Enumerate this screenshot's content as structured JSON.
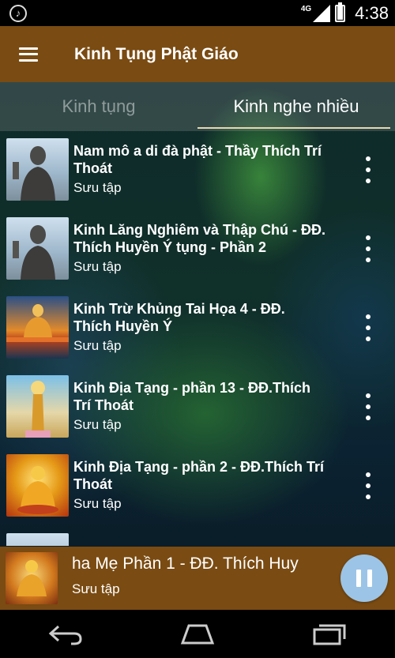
{
  "status_bar": {
    "network": "4G",
    "time": "4:38"
  },
  "toolbar": {
    "title": "Kinh Tụng Phật Giáo"
  },
  "tabs": [
    {
      "label": "Kinh tụng",
      "active": false
    },
    {
      "label": "Kinh nghe nhiều",
      "active": true
    }
  ],
  "list": {
    "items": [
      {
        "title": "Nam mô a di đà phật - Thầy Thích Trí Thoát",
        "subtitle": "Sưu tập",
        "thumb": "buddha-statue"
      },
      {
        "title": "Kinh Lăng Nghiêm và Thập Chú - ĐĐ. Thích Huyền Ý tụng - Phần 2",
        "subtitle": "Sưu tập",
        "thumb": "buddha-statue"
      },
      {
        "title": "Kinh Trừ Khủng Tai Họa 4 - ĐĐ. Thích Huyền Ý",
        "subtitle": "Sưu tập",
        "thumb": "buddha-sunset"
      },
      {
        "title": "Kinh Địa Tạng - phần 13 - ĐĐ.Thích Trí Thoát",
        "subtitle": "Sưu tập",
        "thumb": "bodhisattva-sky"
      },
      {
        "title": "Kinh Địa Tạng - phần 2 - ĐĐ.Thích Trí Thoát",
        "subtitle": "Sưu tập",
        "thumb": "golden-buddha"
      }
    ]
  },
  "now_playing": {
    "title": "ha Mẹ Phần 1 - ĐĐ. Thích Huy",
    "subtitle": "Sưu tập"
  },
  "colors": {
    "toolbar_brown": "#7a4b12",
    "pause_button": "#9cc4e6"
  }
}
